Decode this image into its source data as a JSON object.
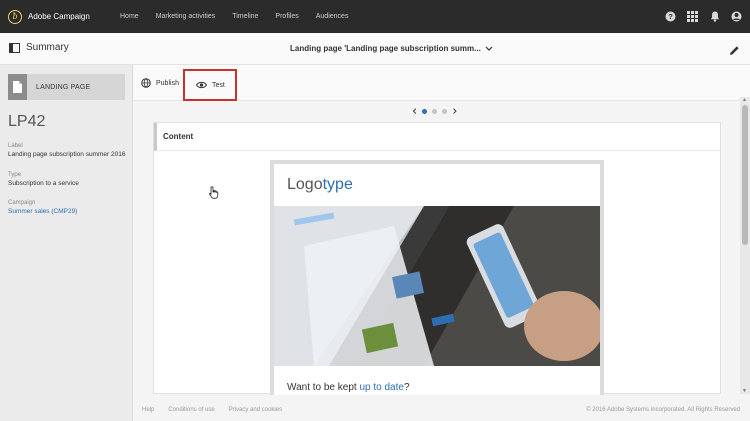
{
  "app": {
    "name": "Adobe Campaign",
    "logo_glyph": "ƀ"
  },
  "nav": {
    "items": [
      "Home",
      "Marketing activities",
      "Timeline",
      "Profiles",
      "Audiences"
    ]
  },
  "top_icons": [
    "help-icon",
    "apps-grid-icon",
    "notifications-bell-icon",
    "user-avatar-icon"
  ],
  "header": {
    "summary_label": "Summary",
    "breadcrumb": "Landing page 'Landing page subscription summ...",
    "dropdown_icon": "chevron-down-icon",
    "edit_icon": "pencil-icon"
  },
  "left_panel": {
    "type_label": "LANDING PAGE",
    "id": "LP42",
    "fields": [
      {
        "label": "Label",
        "value": "Landing page subscription summer 2016"
      },
      {
        "label": "Type",
        "value": "Subscription to a service"
      },
      {
        "label": "Campaign",
        "value": "Summer sales (CMP29)"
      }
    ]
  },
  "toolbar": {
    "publish_label": "Publish",
    "test_label": "Test"
  },
  "pager": {
    "pages": 3,
    "active": 1
  },
  "content": {
    "title": "Content",
    "logo_text_1": "Logo",
    "logo_text_2": "type",
    "headline_1": "Want to be kept ",
    "headline_link": "up to date",
    "headline_2": "?"
  },
  "footer": {
    "links": [
      "Help",
      "Conditions of use",
      "Privacy and cookies"
    ],
    "copyright": "© 2016 Adobe Systems Incorporated. All Rights Reserved"
  },
  "colors": {
    "accent": "#2d6fb2",
    "topbar": "#2b2b2b",
    "highlight": "#c9312c"
  }
}
